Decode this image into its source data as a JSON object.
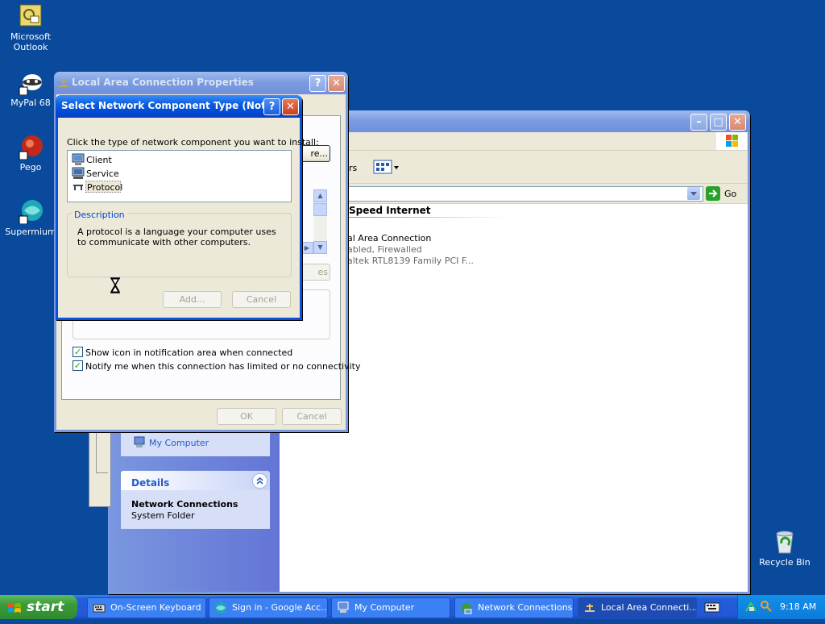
{
  "desktop": {
    "icons": [
      {
        "label": "Microsoft Outlook",
        "line1": "Microsoft",
        "line2": "Outlook"
      },
      {
        "label": "MyPal 68"
      },
      {
        "label": "Pego"
      },
      {
        "label": "Supermium"
      },
      {
        "label": "Recycle Bin"
      }
    ]
  },
  "network_window": {
    "address_dropdown": "",
    "go_label": "Go",
    "toolbar_partial": "rs",
    "group_header": "Speed Internet",
    "connection": {
      "name": "al Area Connection",
      "status": "abled, Firewalled",
      "device": "altek RTL8139 Family PCI F..."
    },
    "other_places_item": "My Computer",
    "details": {
      "header": "Details",
      "title": "Network Connections",
      "subtitle": "System Folder"
    }
  },
  "lac_properties": {
    "title": "Local Area Connection Properties",
    "configure_partial": "re...",
    "properties_partial": "es",
    "checkbox_show_icon": "Show icon in notification area when connected",
    "checkbox_notify": "Notify me when this connection has limited or no connectivity",
    "ok_label": "OK",
    "cancel_label": "Cancel"
  },
  "select_component": {
    "title": "Select Network Component Type (Not...",
    "instruction": "Click the type of network component you want to install:",
    "items": [
      "Client",
      "Service",
      "Protocol"
    ],
    "description_label": "Description",
    "description_text": "A protocol is a language your computer uses to communicate with other computers.",
    "add_label": "Add...",
    "cancel_label": "Cancel"
  },
  "taskbar": {
    "start_label": "start",
    "items": [
      "On-Screen Keyboard",
      "Sign in - Google Acc...",
      "My Computer",
      "Network Connections",
      "Local Area Connecti..."
    ],
    "clock": "9:18 AM"
  }
}
